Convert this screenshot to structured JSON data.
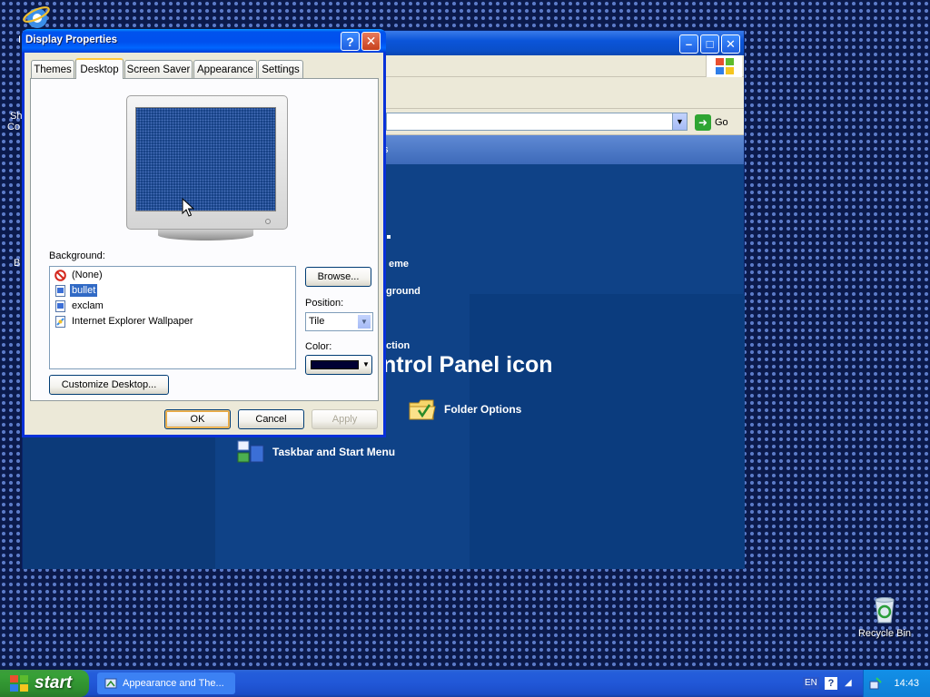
{
  "desktop": {
    "left_fragments": [
      "I",
      "Sh",
      "Co",
      "B"
    ],
    "recycle_bin_label": "Recycle Bin"
  },
  "control_panel": {
    "partial_labels": [
      "s",
      "eme",
      "ground",
      "ction"
    ],
    "heading": "ntrol Panel icon",
    "links": [
      {
        "label": "Folder Options",
        "icon": "folder-icon"
      },
      {
        "label": "Taskbar and Start Menu",
        "icon": "taskbar-icon"
      }
    ],
    "go_label": "Go"
  },
  "dialog": {
    "title": "Display Properties",
    "tabs": [
      {
        "label": "Themes"
      },
      {
        "label": "Desktop",
        "active": true
      },
      {
        "label": "Screen Saver"
      },
      {
        "label": "Appearance"
      },
      {
        "label": "Settings"
      }
    ],
    "background_label": "Background:",
    "background_items": [
      {
        "label": "(None)",
        "icon": "none-icon"
      },
      {
        "label": "bullet",
        "icon": "bitmap-file-icon",
        "selected": true
      },
      {
        "label": "exclam",
        "icon": "bitmap-file-icon"
      },
      {
        "label": "Internet Explorer Wallpaper",
        "icon": "ie-wallpaper-icon"
      }
    ],
    "browse_label": "Browse...",
    "position_label": "Position:",
    "position_value": "Tile",
    "color_label": "Color:",
    "color_value": "#000033",
    "customize_label": "Customize Desktop...",
    "ok_label": "OK",
    "cancel_label": "Cancel",
    "apply_label": "Apply"
  },
  "taskbar": {
    "start_label": "start",
    "task_label": "Appearance and The...",
    "language": "EN",
    "clock": "14:43"
  }
}
